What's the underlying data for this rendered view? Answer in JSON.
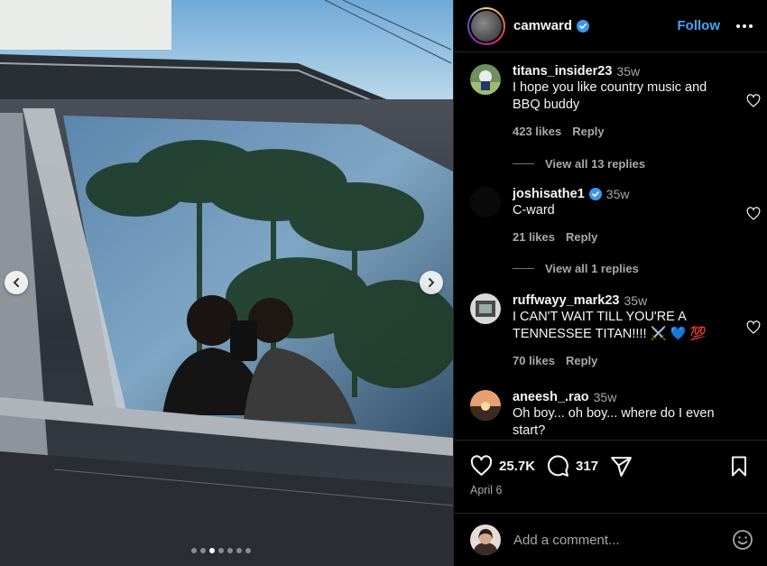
{
  "post": {
    "author": "camward",
    "follow_label": "Follow",
    "likes": "25.7K",
    "comment_count": "317",
    "date": "April 6",
    "carousel": {
      "total": 7,
      "current": 2
    }
  },
  "comments": [
    {
      "user": "titans_insider23",
      "time": "35w",
      "verified": false,
      "text_lines": [
        "I hope you like country music and",
        "BBQ buddy"
      ],
      "likes": "423 likes",
      "reply": "Reply",
      "view_replies": "View all 13 replies"
    },
    {
      "user": "joshisathe1",
      "time": "35w",
      "verified": true,
      "text_lines": [
        "C-ward"
      ],
      "likes": "21 likes",
      "reply": "Reply",
      "view_replies": "View all 1 replies"
    },
    {
      "user": "ruffwayy_mark23",
      "time": "35w",
      "verified": false,
      "text_lines": [
        "I CAN'T WAIT TILL YOU'RE A",
        "TENNESSEE TITAN!!!! ⚔️ 💙 💯"
      ],
      "likes": "70 likes",
      "reply": "Reply"
    },
    {
      "user": "aneesh_.rao",
      "time": "35w",
      "verified": false,
      "text_lines": [
        "Oh boy... oh boy... where do I even",
        "start?"
      ]
    }
  ],
  "add_comment": {
    "placeholder": "Add a comment..."
  },
  "colors": {
    "accent": "#4aa3ff",
    "verified": "#3897f0",
    "background": "#000000",
    "muted": "#a8a8a8"
  },
  "icons": [
    "chevron-left-icon",
    "chevron-right-icon",
    "verified-icon",
    "more-icon",
    "heart-icon",
    "comment-icon",
    "share-icon",
    "bookmark-icon",
    "emoji-icon"
  ]
}
